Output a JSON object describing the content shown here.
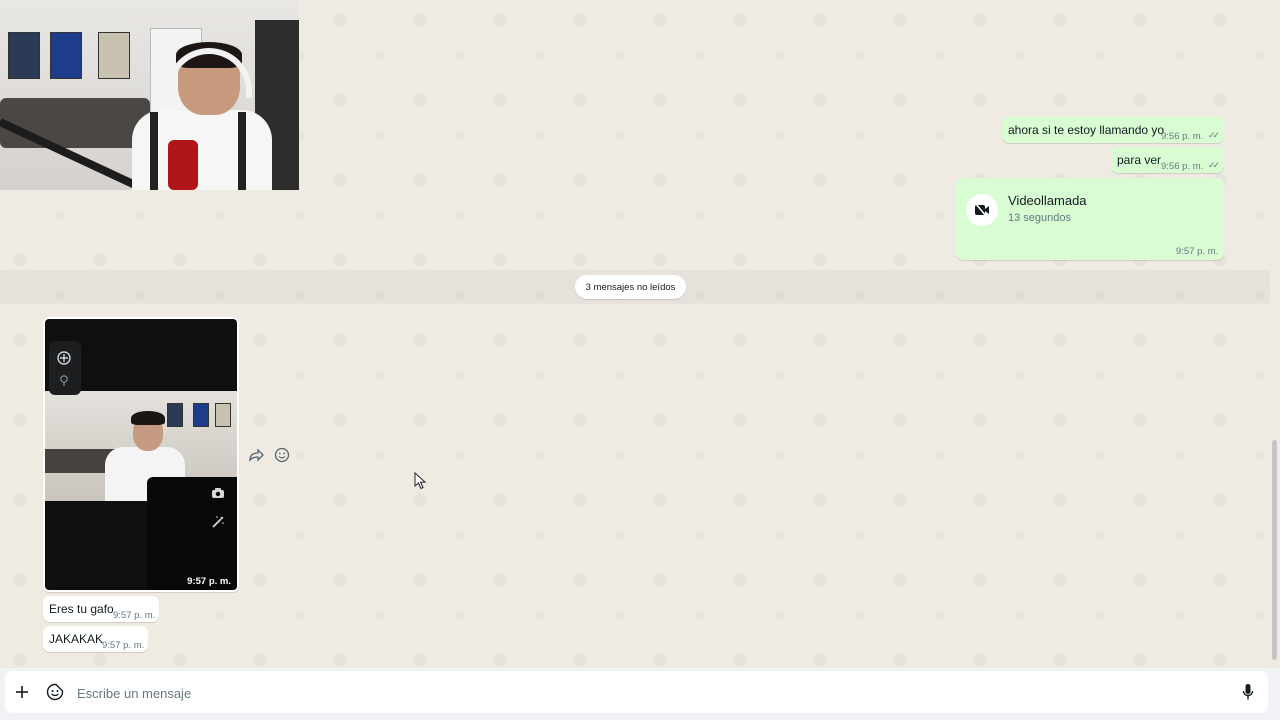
{
  "outgoing": [
    {
      "text": "ahora si te estoy llamando yo",
      "time": "9:56 p. m."
    },
    {
      "text": "para ver",
      "time": "9:56 p. m."
    }
  ],
  "call": {
    "title": "Videollamada",
    "duration": "13 segundos",
    "time": "9:57 p. m."
  },
  "unread_divider": "3 mensajes no leídos",
  "incoming_image": {
    "time": "9:57 p. m."
  },
  "incoming": [
    {
      "text": "Eres tu gafo",
      "time": "9:57 p. m."
    },
    {
      "text": "JAKAKAK",
      "time": "9:57 p. m."
    }
  ],
  "composer": {
    "placeholder": "Escribe un mensaje"
  },
  "icons": {
    "attach": "plus-icon",
    "emoji": "sticker-emoji-icon",
    "mic": "microphone-icon",
    "forward": "forward-icon",
    "react": "emoji-react-icon",
    "video": "video-camera-icon"
  },
  "colors": {
    "outgoing_bubble": "#d9fdd3",
    "incoming_bubble": "#ffffff",
    "chat_bg": "#efeae2"
  }
}
